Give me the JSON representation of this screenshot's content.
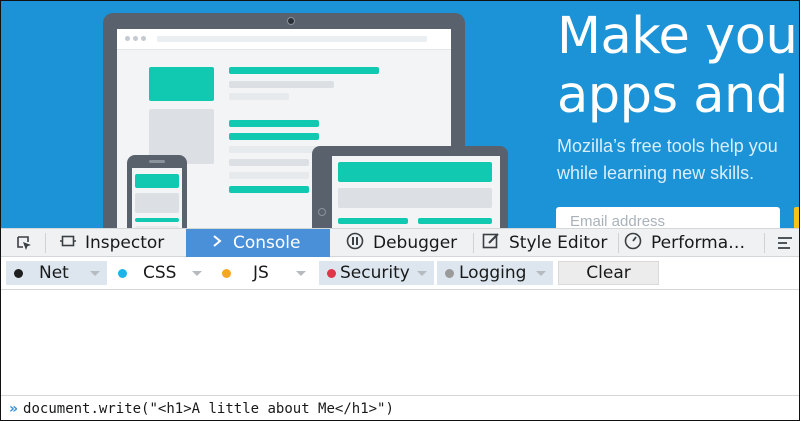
{
  "hero": {
    "headline_line1": "Make your",
    "headline_line2": "apps and w",
    "sub_line1": "Mozilla’s free tools help you",
    "sub_line2": "while learning new skills.",
    "email_placeholder": "Email address"
  },
  "devtools": {
    "tabs": [
      {
        "label": "Inspector",
        "icon": "inspector-icon"
      },
      {
        "label": "Console",
        "icon": "console-icon",
        "active": true
      },
      {
        "label": "Debugger",
        "icon": "debugger-icon"
      },
      {
        "label": "Style Editor",
        "icon": "style-editor-icon"
      },
      {
        "label": "Performa…",
        "icon": "performance-icon"
      }
    ],
    "filters": [
      {
        "label": "Net",
        "color": "#1f1f1f",
        "active": true
      },
      {
        "label": "CSS",
        "color": "#1db4ea",
        "active": false
      },
      {
        "label": "JS",
        "color": "#f5a623",
        "active": false
      },
      {
        "label": "Security",
        "color": "#e0364a",
        "active": true
      },
      {
        "label": "Logging",
        "color": "#9a9a9a",
        "active": true
      }
    ],
    "clear_label": "Clear",
    "input_command": "document.write(\"<h1>A little about Me</h1>\")"
  },
  "colors": {
    "hero_bg": "#1b93d6",
    "active_tab": "#4a90d9",
    "teal": "#11c9b0"
  }
}
